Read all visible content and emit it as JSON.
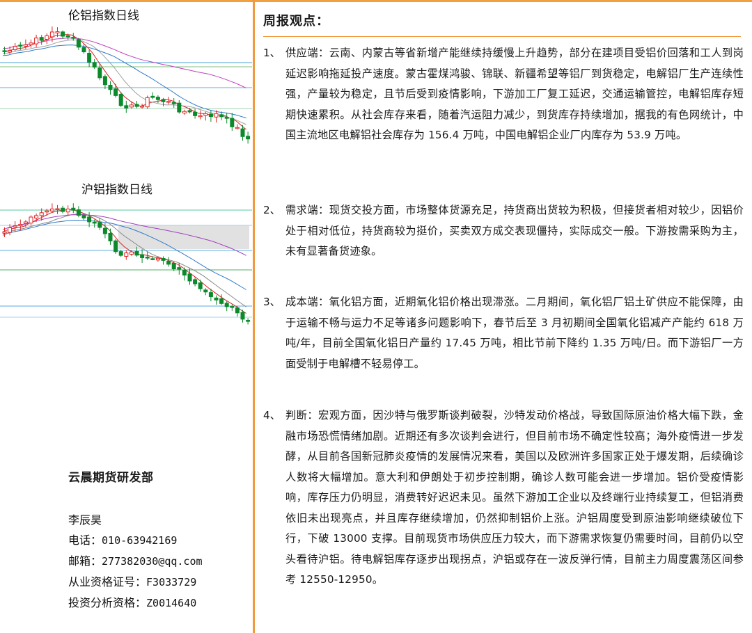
{
  "left": {
    "chart1_title": "伦铝指数日线",
    "chart2_title": "沪铝指数日线",
    "contact": {
      "dept": "云晨期货研发部",
      "name": "李辰昊",
      "phone_label": "电话：",
      "phone": "010-63942169",
      "email_label": "邮箱：",
      "email": "277382030@qq.com",
      "license_label": "从业资格证号：",
      "license": "F3033729",
      "advisor_label": "投资分析资格：",
      "advisor": "Z0014640"
    }
  },
  "right": {
    "section_title": "周报观点：",
    "points": [
      {
        "num": "1、",
        "text": "供应端：云南、内蒙古等省新增产能继续持缓慢上升趋势，部分在建项目受铝价回落和工人到岗延迟影响拖延投产速度。蒙古霍煤鸿骏、锦联、新疆希望等铝厂到货稳定，电解铝厂生产连续性强，产量较为稳定，且节后受到疫情影响，下游加工厂复工延迟，交通运输管控，电解铝库存短期快速累积。从社会库存来看，随着汽运阻力减少，到货库存持续增加，据我的有色网统计，中国主流地区电解铝社会库存为 156.4 万吨，中国电解铝企业厂内库存为 53.9 万吨。"
      },
      {
        "num": "2、",
        "text": "需求端：现货交投方面，市场整体货源充足，持货商出货较为积极，但接货者相对较少，因铝价处于相对低位，持货商较为挺价，买卖双方成交表现僵持，实际成交一般。下游按需采购为主，未有显著备货迹象。"
      },
      {
        "num": "3、",
        "text": "成本端：氧化铝方面，近期氧化铝价格出现滞涨。二月期间，氧化铝厂铝土矿供应不能保障，由于运输不畅与运力不足等诸多问题影响下，春节后至 3 月初期间全国氧化铝减产产能约 618 万吨/年，目前全国氧化铝日产量约 17.45 万吨，相比节前下降约 1.35 万吨/日。而下游铝厂一方面受制于电解槽不轻易停工。"
      },
      {
        "num": "4、",
        "text": "判断：宏观方面，因沙特与俄罗斯谈判破裂，沙特发动价格战，导致国际原油价格大幅下跌，金融市场恐慌情绪加剧。近期还有多次谈判会进行，但目前市场不确定性较高；海外疫情进一步发酵，从目前各国新冠肺炎疫情的发展情况来看，美国以及欧洲许多国家正处于爆发期，后续确诊人数将大幅增加。意大利和伊朗处于初步控制期，确诊人数可能会进一步增加。铝价受疫情影响，库存压力仍明显，消费转好迟迟未见。虽然下游加工企业以及终端行业持续复工，但铝消费依旧未出现亮点，并且库存继续增加，仍然抑制铝价上涨。沪铝周度受到原油影响继续破位下行，下破 13000 支撑。目前现货市场供应压力较大，而下游需求恢复仍需要时间，目前仍以空头看待沪铝。待电解铝库存逐步出现拐点，沪铝或存在一波反弹行情，目前主力周度震荡区间参考 12550-12950。"
      }
    ]
  }
}
